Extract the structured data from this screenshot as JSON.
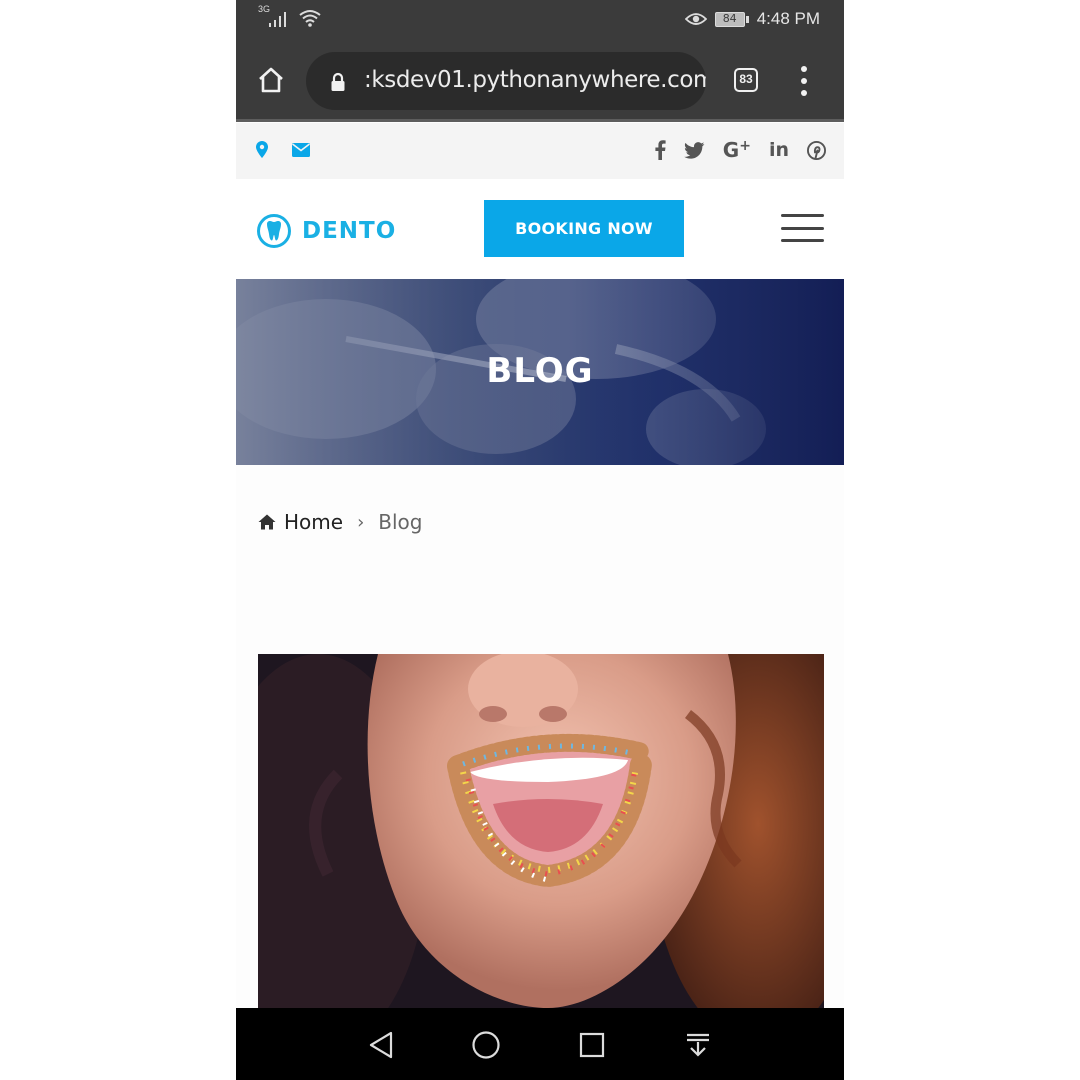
{
  "status_bar": {
    "network": "3G",
    "battery": "84",
    "time": "4:48 PM"
  },
  "browser": {
    "url": ":ksdev01.pythonanywhere.com",
    "tab_count": "83"
  },
  "brand": {
    "name": "DENTO",
    "accent": "#0aa7e8"
  },
  "header": {
    "booking_label": "BOOKING NOW"
  },
  "hero": {
    "title": "BLOG"
  },
  "breadcrumb": {
    "home": "Home",
    "current": "Blog"
  },
  "social_icons": [
    "facebook-icon",
    "twitter-icon",
    "google-plus-icon",
    "linkedin-icon",
    "pinterest-icon"
  ],
  "blog_image": {
    "description_icon": "photo"
  }
}
